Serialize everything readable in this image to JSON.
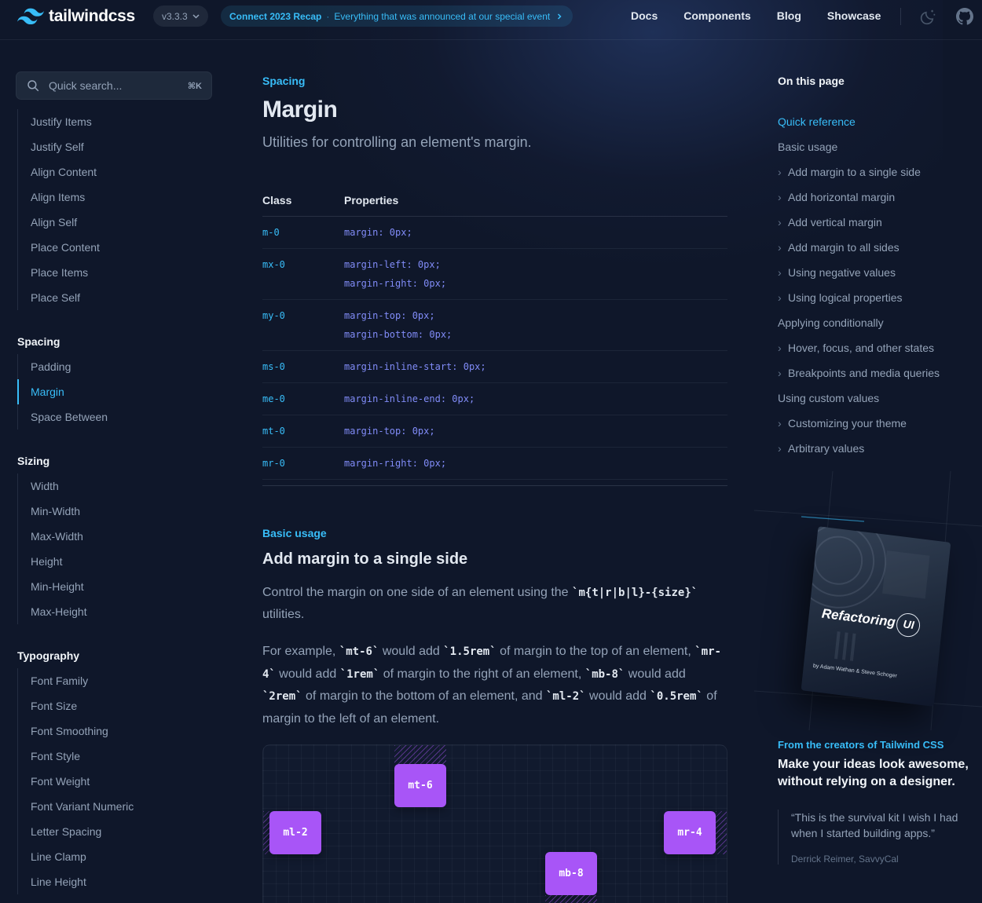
{
  "header": {
    "logo_text": "tailwindcss",
    "version": "v3.3.3",
    "announcement": {
      "label": "Connect 2023 Recap",
      "text": "Everything that was announced at our special event"
    },
    "nav": [
      "Docs",
      "Components",
      "Blog",
      "Showcase"
    ]
  },
  "search": {
    "placeholder": "Quick search...",
    "shortcut": "⌘K"
  },
  "sidebar": {
    "alignment_items": [
      "Justify Items",
      "Justify Self",
      "Align Content",
      "Align Items",
      "Align Self",
      "Place Content",
      "Place Items",
      "Place Self"
    ],
    "spacing": {
      "heading": "Spacing",
      "items": [
        "Padding",
        "Margin",
        "Space Between"
      ]
    },
    "sizing": {
      "heading": "Sizing",
      "items": [
        "Width",
        "Min-Width",
        "Max-Width",
        "Height",
        "Min-Height",
        "Max-Height"
      ]
    },
    "typography": {
      "heading": "Typography",
      "items": [
        "Font Family",
        "Font Size",
        "Font Smoothing",
        "Font Style",
        "Font Weight",
        "Font Variant Numeric",
        "Letter Spacing",
        "Line Clamp",
        "Line Height"
      ]
    }
  },
  "page": {
    "eyebrow": "Spacing",
    "title": "Margin",
    "lead": "Utilities for controlling an element's margin.",
    "table": {
      "headers": [
        "Class",
        "Properties"
      ],
      "rows": [
        {
          "cls": "m-0",
          "props": [
            "margin: 0px;"
          ]
        },
        {
          "cls": "mx-0",
          "props": [
            "margin-left: 0px;",
            "margin-right: 0px;"
          ]
        },
        {
          "cls": "my-0",
          "props": [
            "margin-top: 0px;",
            "margin-bottom: 0px;"
          ]
        },
        {
          "cls": "ms-0",
          "props": [
            "margin-inline-start: 0px;"
          ]
        },
        {
          "cls": "me-0",
          "props": [
            "margin-inline-end: 0px;"
          ]
        },
        {
          "cls": "mt-0",
          "props": [
            "margin-top: 0px;"
          ]
        },
        {
          "cls": "mr-0",
          "props": [
            "margin-right: 0px;"
          ]
        }
      ]
    },
    "section_eyebrow": "Basic usage",
    "section_title": "Add margin to a single side",
    "p1": {
      "a": "Control the margin on one side of an element using the ",
      "code": "`m{t|r|b|l}-{size}`",
      "b": " utilities."
    },
    "p2": {
      "t1": "For example, ",
      "c1": "`mt-6`",
      "t2": " would add ",
      "c2": "`1.5rem`",
      "t3": " of margin to the top of an element, ",
      "c3": "`mr-4`",
      "t4": " would add ",
      "c4": "`1rem`",
      "t5": " of margin to the right of an element, ",
      "c5": "`mb-8`",
      "t6": " would add ",
      "c6": "`2rem`",
      "t7": " of margin to the bottom of an element, and ",
      "c7": "`ml-2`",
      "t8": " would add ",
      "c8": "`0.5rem`",
      "t9": " of margin to the left of an element."
    },
    "demo_boxes": [
      "mt-6",
      "ml-2",
      "mr-4",
      "mb-8"
    ]
  },
  "toc": {
    "title": "On this page",
    "items": [
      {
        "label": "Quick reference",
        "level": 0,
        "active": true
      },
      {
        "label": "Basic usage",
        "level": 0
      },
      {
        "label": "Add margin to a single side",
        "level": 1
      },
      {
        "label": "Add horizontal margin",
        "level": 1
      },
      {
        "label": "Add vertical margin",
        "level": 1
      },
      {
        "label": "Add margin to all sides",
        "level": 1
      },
      {
        "label": "Using negative values",
        "level": 1
      },
      {
        "label": "Using logical properties",
        "level": 1
      },
      {
        "label": "Applying conditionally",
        "level": 0
      },
      {
        "label": "Hover, focus, and other states",
        "level": 1
      },
      {
        "label": "Breakpoints and media queries",
        "level": 1
      },
      {
        "label": "Using custom values",
        "level": 0
      },
      {
        "label": "Customizing your theme",
        "level": 1
      },
      {
        "label": "Arbitrary values",
        "level": 1
      }
    ]
  },
  "promo": {
    "book_title": "Refactoring",
    "book_ui": "UI",
    "book_by": "by Adam Wathan & Steve Schoger",
    "eyebrow": "From the creators of Tailwind CSS",
    "headline": "Make your ideas look awesome, without relying on a designer.",
    "quote": "“This is the survival kit I wish I had when I started building apps.”",
    "author": "Derrick Reimer, SavvyCal"
  },
  "colors": {
    "accent": "#38bdf8",
    "purple": "#a855f7",
    "bg": "#0f172a"
  }
}
